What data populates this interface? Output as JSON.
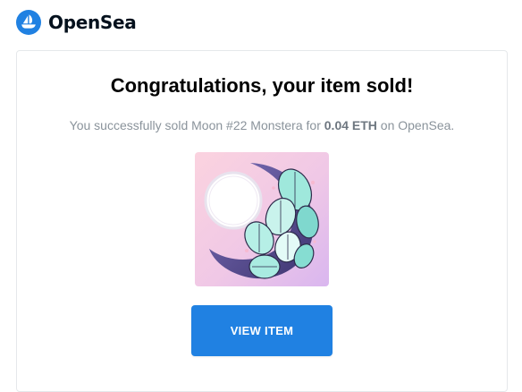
{
  "header": {
    "brand": "OpenSea",
    "logo_icon": "opensea-logo-icon",
    "brand_color": "#2081e2"
  },
  "email": {
    "title": "Congratulations, your item sold!",
    "message_prefix": "You successfully sold Moon #22 Monstera for ",
    "amount": "0.04 ETH",
    "message_suffix": " on OpenSea.",
    "item_image": "moon-monstera-artwork",
    "button_label": "VIEW ITEM",
    "button_color": "#2081e2"
  }
}
